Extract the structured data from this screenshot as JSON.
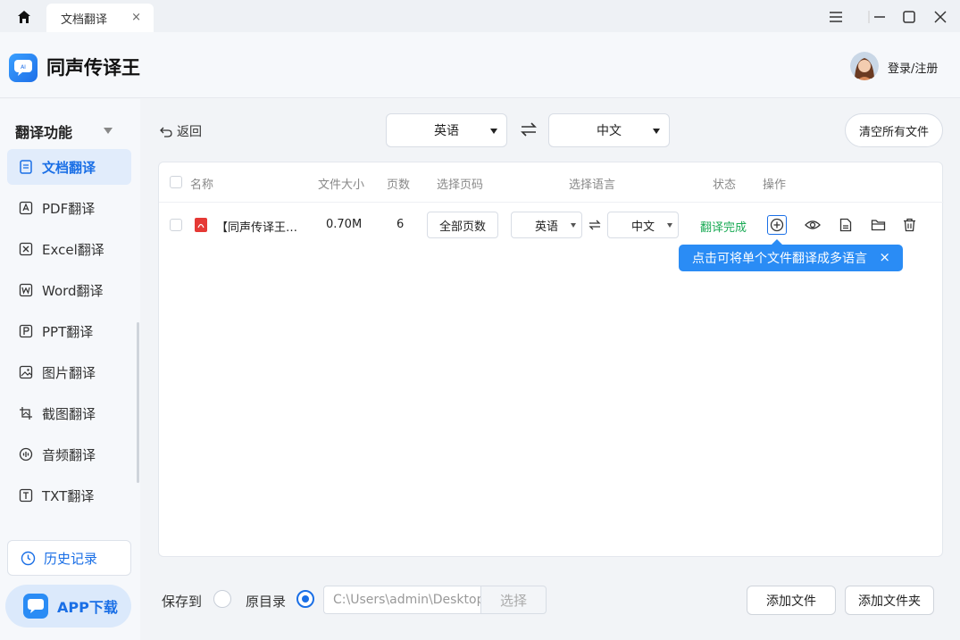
{
  "titlebar": {
    "tab_label": "文档翻译",
    "tab_close": "×"
  },
  "header": {
    "app_name": "同声传译王",
    "login_label": "登录/注册"
  },
  "sidebar": {
    "heading": "翻译功能",
    "items": [
      {
        "label": "文档翻译",
        "icon": "document-icon",
        "active": true
      },
      {
        "label": "PDF翻译",
        "icon": "pdf-icon",
        "active": false
      },
      {
        "label": "Excel翻译",
        "icon": "excel-icon",
        "active": false
      },
      {
        "label": "Word翻译",
        "icon": "word-icon",
        "active": false
      },
      {
        "label": "PPT翻译",
        "icon": "ppt-icon",
        "active": false
      },
      {
        "label": "图片翻译",
        "icon": "image-icon",
        "active": false
      },
      {
        "label": "截图翻译",
        "icon": "screenshot-icon",
        "active": false
      },
      {
        "label": "音频翻译",
        "icon": "audio-icon",
        "active": false
      },
      {
        "label": "TXT翻译",
        "icon": "txt-icon",
        "active": false
      }
    ],
    "history_label": "历史记录",
    "app_download_label": "APP下载"
  },
  "toolbar": {
    "back_label": "返回",
    "source_lang": "英语",
    "target_lang": "中文",
    "clear_label": "清空所有文件"
  },
  "table": {
    "headers": {
      "name": "名称",
      "size": "文件大小",
      "pages": "页数",
      "select_pages": "选择页码",
      "select_lang": "选择语言",
      "status": "状态",
      "actions": "操作"
    },
    "rows": [
      {
        "name": "【同声传译王…",
        "size": "0.70M",
        "pages": "6",
        "page_range": "全部页数",
        "source_lang": "英语",
        "target_lang": "中文",
        "status": "翻译完成"
      }
    ]
  },
  "tooltip": {
    "text": "点击可将单个文件翻译成多语言",
    "close": "×"
  },
  "footer": {
    "save_to_label": "保存到",
    "original_dir_label": "原目录",
    "path_value": "C:\\Users\\admin\\Desktop",
    "pick_label": "选择",
    "add_file_label": "添加文件",
    "add_folder_label": "添加文件夹"
  },
  "colors": {
    "accent": "#1a6fe6",
    "tooltip_bg": "#2a8cf5",
    "status_done": "#1aaa55",
    "pdf_red": "#e53935"
  }
}
